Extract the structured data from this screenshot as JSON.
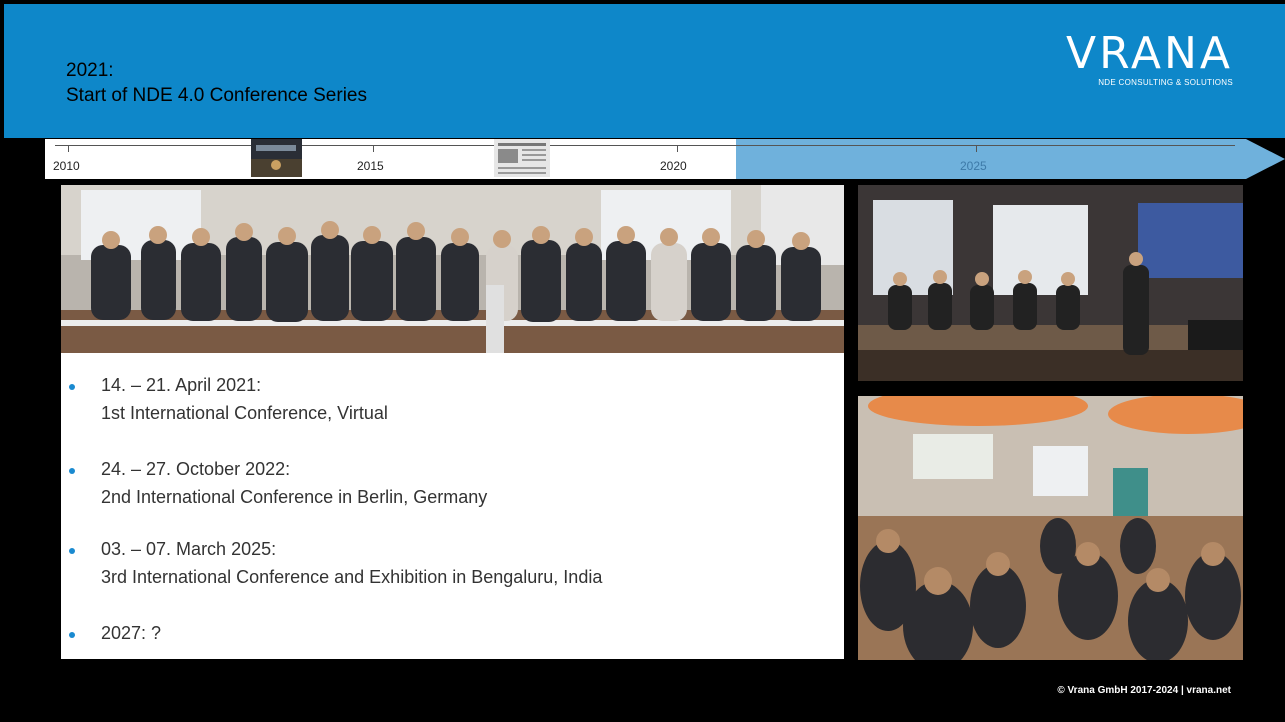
{
  "header": {
    "title_line1": "2021:",
    "title_line2": "Start of NDE 4.0 Conference Series",
    "logo": {
      "word": "VRANA",
      "tagline": "NDE CONSULTING & SOLUTIONS"
    },
    "colors": {
      "band": "#0e87c9",
      "accent": "#1a8ad0"
    }
  },
  "timeline": {
    "years": [
      "2010",
      "2015",
      "2020",
      "2025"
    ]
  },
  "bullets": [
    {
      "line1": "14. – 21. April 2021:",
      "line2": "1st International Conference, Virtual"
    },
    {
      "line1": "24. – 27. October 2022:",
      "line2": "2nd International Conference in Berlin, Germany"
    },
    {
      "line1": "03. – 07. March 2025:",
      "line2": "3rd International Conference and Exhibition in Bengaluru, India"
    },
    {
      "line1": "2027: ?"
    }
  ],
  "footer": {
    "copyright": "© Vrana GmbH 2017-2024 | vrana.net"
  }
}
